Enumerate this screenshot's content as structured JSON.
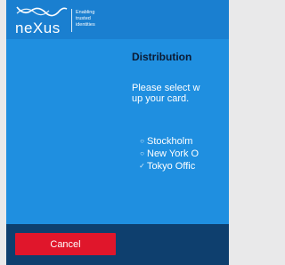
{
  "header": {
    "brand": "neXus",
    "tagline_lines": [
      "Enabling",
      "trusted",
      "identities"
    ]
  },
  "dialog": {
    "title": "Distribution",
    "instruction_lines": [
      "Please select w",
      "up your card."
    ],
    "options": [
      {
        "label": "Stockholm",
        "selected": false
      },
      {
        "label": "New York O",
        "selected": false
      },
      {
        "label": "Tokyo Offic",
        "selected": true
      }
    ]
  },
  "footer": {
    "cancel_label": "Cancel"
  },
  "colors": {
    "body": "#1f8fe0",
    "header": "#1a7fd0",
    "footer": "#0e3f6e",
    "cancel": "#e0162b",
    "title": "#0b1a33"
  }
}
